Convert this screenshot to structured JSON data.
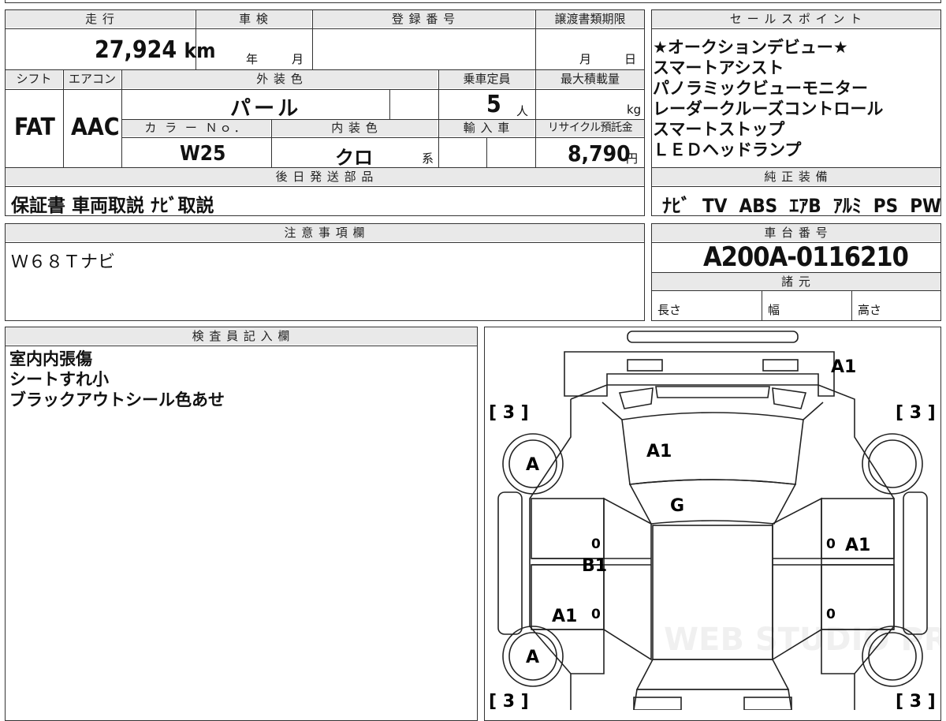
{
  "vehicle": {
    "mileage_label": "走 行",
    "mileage": "27,924",
    "mileage_unit": "km",
    "inspection_label": "車 検",
    "year_unit": "年",
    "month_unit": "月",
    "registration_label": "登 録 番 号",
    "deadline_label": "譲渡書類期限",
    "deadline_month": "月",
    "deadline_day": "日",
    "shift_label": "シフト",
    "shift": "FAT",
    "aircon_label": "エアコン",
    "aircon": "AAC",
    "exterior_label": "外 装 色",
    "exterior": "パ ー ル",
    "capacity_label": "乗車定員",
    "capacity": "5",
    "capacity_unit": "人",
    "maxload_label": "最大積載量",
    "maxload_unit": "kg",
    "color_no_label": "カ ラ ー Ｎｏ．",
    "color_no": "W25",
    "interior_label": "内 装 色",
    "interior": "クロ",
    "interior_suffix": "系",
    "import_label": "輸 入 車",
    "recycle_label": "リサイクル預託金",
    "recycle": "8,790",
    "recycle_unit": "円"
  },
  "shipping": {
    "label": "後 日 発 送 部 品",
    "value": "保証書 車両取説 ﾅﾋﾞ取説"
  },
  "sales": {
    "label": "セ ー ル ス ポ イ ン ト",
    "items": [
      "★オークションデビュー★",
      "スマートアシスト",
      "パノラミックビューモニター",
      "レーダークルーズコントロール",
      "スマートストップ",
      "ＬＥＤヘッドランプ"
    ]
  },
  "equipment": {
    "label": "純 正 装 備",
    "items": [
      "ﾅﾋﾞ",
      "TV",
      "ABS",
      "ｴｱB",
      "ｱﾙﾐ",
      "PS",
      "PW"
    ]
  },
  "notes": {
    "label": "注 意 事 項 欄",
    "value": "Ｗ６８Ｔナビ"
  },
  "chassis": {
    "label": "車 台 番 号",
    "value": "A200A-0116210",
    "spec_label": "諸 元",
    "length_label": "長さ",
    "width_label": "幅",
    "height_label": "高さ"
  },
  "inspector": {
    "label": "検 査 員 記 入 欄",
    "lines": [
      "室内内張傷",
      "シートすれ小",
      "ブラックアウトシール色あせ"
    ]
  },
  "diagram": {
    "tire_marks": [
      "[ 3 ]",
      "[ 3 ]",
      "[ 3 ]",
      "[ 3 ]"
    ],
    "wheel_marks": [
      "A",
      "A"
    ],
    "damage_codes": {
      "rear_bumper": "A1",
      "hood": "A1",
      "windshield": "G",
      "right_door": "A1",
      "left_door": "B1",
      "left_rear_door": "A1"
    },
    "zero_marks": [
      "0",
      "0",
      "0",
      "0"
    ],
    "watermark": "WEB STUDIO PRO"
  }
}
